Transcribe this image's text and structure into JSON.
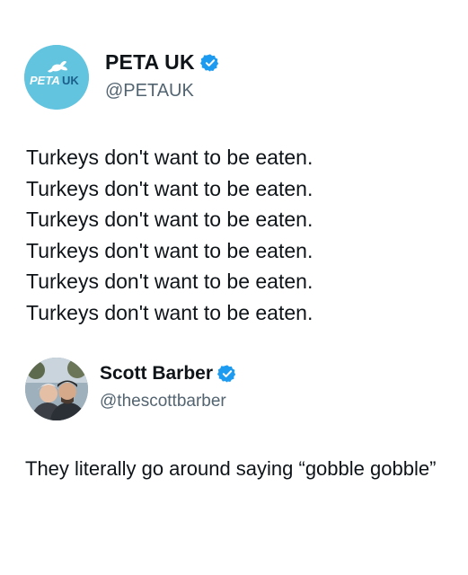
{
  "tweet": {
    "author": {
      "display_name": "PETA UK",
      "handle": "@PETAUK",
      "verified": true,
      "avatar_text": "PETA UK",
      "avatar_color": "#63c4df"
    },
    "lines": [
      "Turkeys don't want to be eaten.",
      "Turkeys don't want to be eaten.",
      "Turkeys don't want to be eaten.",
      "Turkeys don't want to be eaten.",
      "Turkeys don't want to be eaten.",
      "Turkeys don't want to be eaten."
    ]
  },
  "reply": {
    "author": {
      "display_name": "Scott Barber",
      "handle": "@thescottbarber",
      "verified": true
    },
    "text": "They literally go around saying “gobble gobble”"
  },
  "colors": {
    "verified_badge": "#1d9bf0",
    "handle_text": "#536471",
    "body_text": "#0f1419"
  }
}
